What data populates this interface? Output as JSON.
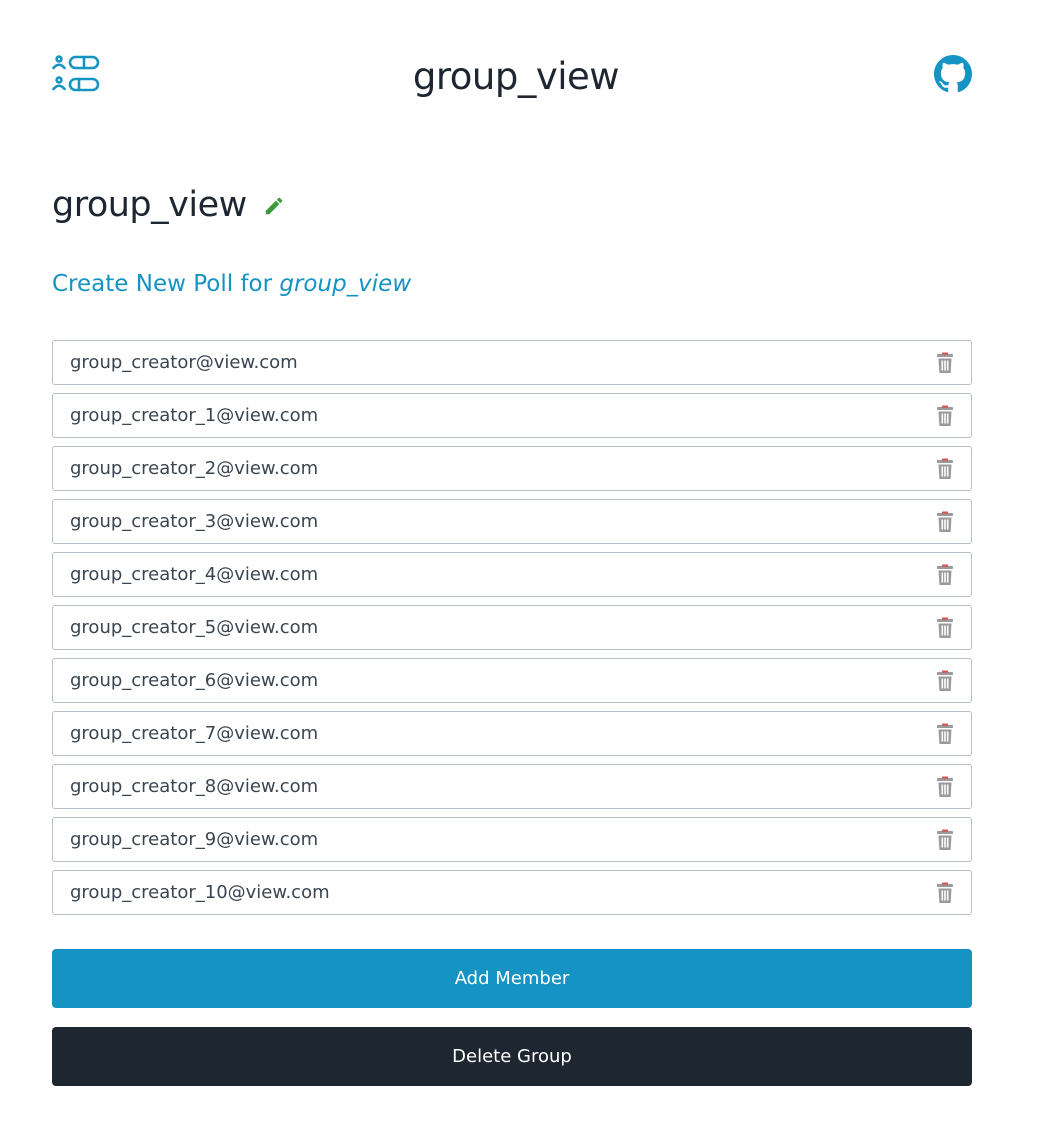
{
  "header": {
    "title": "group_view",
    "logo_icon": "poll-list-logo-icon",
    "github_icon": "github-icon"
  },
  "group": {
    "name": "group_view",
    "edit_icon": "pencil-icon"
  },
  "create_poll": {
    "prefix": "Create New Poll for ",
    "group_name": "group_view"
  },
  "members": [
    "group_creator@view.com",
    "group_creator_1@view.com",
    "group_creator_2@view.com",
    "group_creator_3@view.com",
    "group_creator_4@view.com",
    "group_creator_5@view.com",
    "group_creator_6@view.com",
    "group_creator_7@view.com",
    "group_creator_8@view.com",
    "group_creator_9@view.com",
    "group_creator_10@view.com"
  ],
  "actions": {
    "add_member_label": "Add Member",
    "delete_group_label": "Delete Group"
  },
  "colors": {
    "accent": "#1593c2",
    "dark": "#1e2731",
    "edit_green": "#3b9a3b",
    "trash_gray": "#9a9a9a",
    "trash_red_accent": "#d9534f",
    "border": "#b9bfc6"
  }
}
